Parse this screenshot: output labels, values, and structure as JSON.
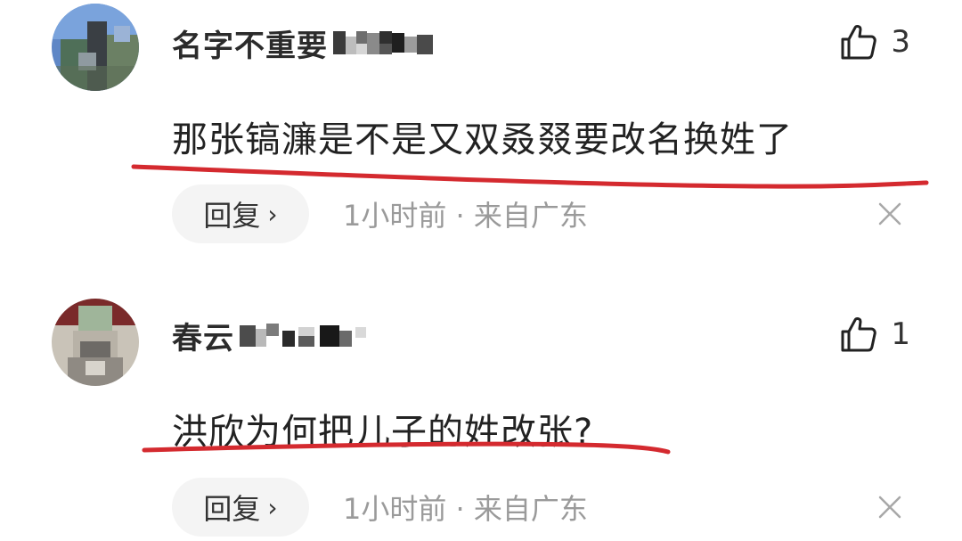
{
  "colors": {
    "underline": "#d42a2f",
    "reply_bg": "#f4f4f4",
    "meta_text": "#9a9a9a"
  },
  "comments": [
    {
      "username": "名字不重要",
      "like_count": "3",
      "text": "那张镐濂是不是又双叒叕要改名换姓了",
      "reply_label": "回复",
      "reply_chevron": "›",
      "meta": "1小时前 · 来自广东",
      "icons": [
        "avatar",
        "thumbs-up-icon",
        "chevron-right-icon",
        "close-icon"
      ]
    },
    {
      "username": "春云",
      "like_count": "1",
      "text": "洪欣为何把儿子的姓改张?",
      "reply_label": "回复",
      "reply_chevron": "›",
      "meta": "1小时前 · 来自广东",
      "icons": [
        "avatar",
        "thumbs-up-icon",
        "chevron-right-icon",
        "close-icon"
      ]
    }
  ]
}
